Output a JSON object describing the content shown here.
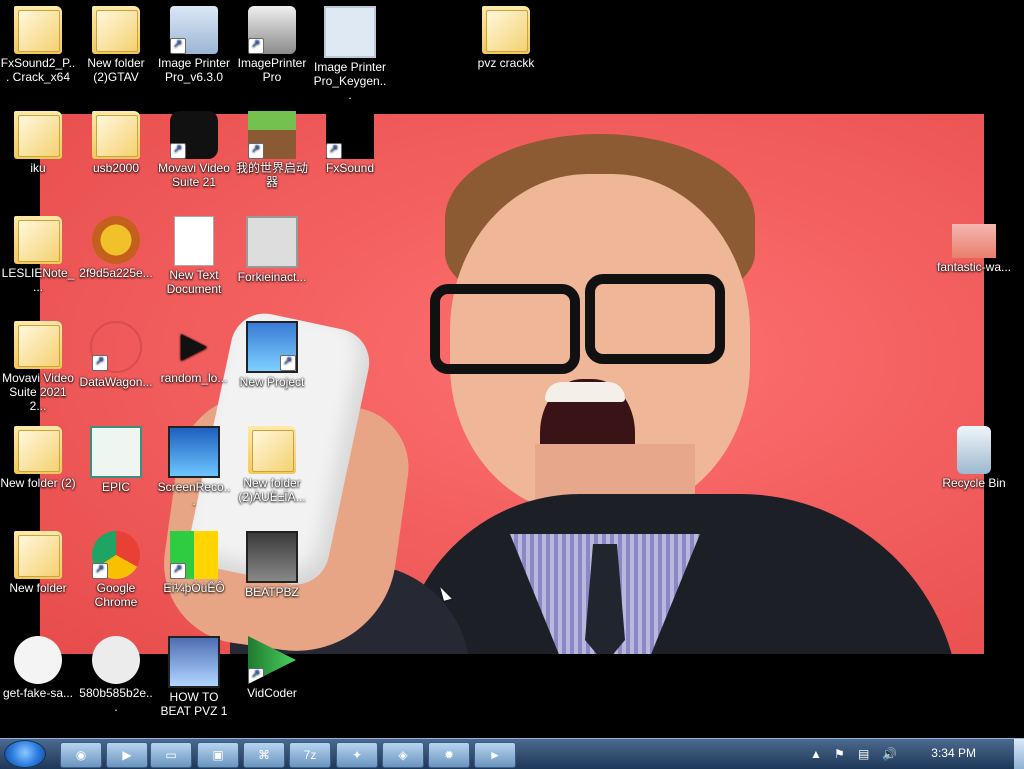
{
  "desktop": {
    "icons": [
      {
        "label": "FxSound2_P... Crack_x64",
        "icon": "folder-icon"
      },
      {
        "label": "New folder (2)GTAV",
        "icon": "folder-icon"
      },
      {
        "label": "Image Printer Pro_v6.3.0",
        "icon": "installer-icon"
      },
      {
        "label": "ImagePrinter Pro",
        "icon": "printer-icon"
      },
      {
        "label": "Image Printer Pro_Keygen...",
        "icon": "window-icon"
      },
      {
        "label": "pvz crackk",
        "icon": "folder-icon"
      },
      {
        "label": "iku",
        "icon": "folder-icon"
      },
      {
        "label": "usb2000",
        "icon": "folder-icon"
      },
      {
        "label": "Movavi Video Suite 21",
        "icon": "movavi-icon"
      },
      {
        "label": "我的世界启动器",
        "icon": "minecraft-icon"
      },
      {
        "label": "FxSound",
        "icon": "fxsound-icon"
      },
      {
        "label": "LESLIENote_...",
        "icon": "folder-icon"
      },
      {
        "label": "2f9d5a225e...",
        "icon": "image-icon"
      },
      {
        "label": "New Text Document",
        "icon": "text-file-icon"
      },
      {
        "label": "Forkieinact...",
        "icon": "window-icon"
      },
      {
        "label": "fantastic-wa...",
        "icon": "image-icon"
      },
      {
        "label": "Movavi Video Suite 2021 2...",
        "icon": "folder-icon"
      },
      {
        "label": "DataWagon...",
        "icon": "atom-icon"
      },
      {
        "label": "random_lo...",
        "icon": "play-icon"
      },
      {
        "label": "New Project",
        "icon": "video-project-icon"
      },
      {
        "label": "New folder (2)",
        "icon": "folder-icon"
      },
      {
        "label": "EPIC",
        "icon": "epic-icon"
      },
      {
        "label": "ScreenReco...",
        "icon": "video-project-icon"
      },
      {
        "label": "New folder (2)ÀUË±ÎA...",
        "icon": "folder-icon"
      },
      {
        "label": "Recycle Bin",
        "icon": "recycle-bin-icon"
      },
      {
        "label": "New folder",
        "icon": "folder-icon"
      },
      {
        "label": "Google Chrome",
        "icon": "chrome-icon"
      },
      {
        "label": "Eî¼þÒüÊÔ",
        "icon": "tiles-icon"
      },
      {
        "label": "BEATPBZ",
        "icon": "video-project-icon"
      },
      {
        "label": "get-fake-sa...",
        "icon": "trollface-icon"
      },
      {
        "label": "580b585b2e...",
        "icon": "trollface-icon"
      },
      {
        "label": "HOW TO BEAT PVZ 1",
        "icon": "video-project-icon"
      },
      {
        "label": "VidCoder",
        "icon": "vidcoder-icon"
      }
    ]
  },
  "taskbar": {
    "apps": [
      {
        "name": "chrome-icon"
      },
      {
        "name": "media-player-icon"
      },
      {
        "name": "explorer-icon"
      },
      {
        "name": "screenshot-icon"
      },
      {
        "name": "control-panel-icon"
      },
      {
        "name": "7zip-icon"
      },
      {
        "name": "generic-app-icon"
      },
      {
        "name": "photos-icon"
      },
      {
        "name": "settings-icon"
      },
      {
        "name": "vidcoder-icon"
      }
    ],
    "tray": {
      "clock": "3:34 PM"
    },
    "seven_zip_label": "7z"
  }
}
